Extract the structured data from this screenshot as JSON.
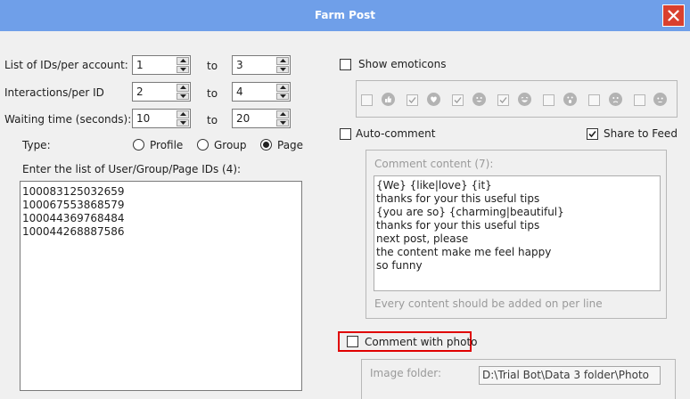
{
  "window": {
    "title": "Farm Post"
  },
  "left": {
    "ids_per_account": {
      "label": "List of IDs/per account:",
      "from": "1",
      "to_label": "to",
      "to": "3"
    },
    "interactions": {
      "label": "Interactions/per ID",
      "from": "2",
      "to_label": "to",
      "to": "4"
    },
    "waiting": {
      "label": "Waiting time (seconds):",
      "from": "10",
      "to_label": "to",
      "to": "20"
    },
    "type": {
      "label": "Type:",
      "options": [
        {
          "label": "Profile",
          "selected": false
        },
        {
          "label": "Group",
          "selected": false
        },
        {
          "label": "Page",
          "selected": true
        }
      ]
    },
    "ids_list_label": "Enter the list of User/Group/Page IDs (4):",
    "ids": [
      "100083125032659",
      "100067553868579",
      "100044369768484",
      "100044268887586"
    ]
  },
  "right": {
    "show_emoticons": {
      "label": "Show emoticons",
      "checked": false
    },
    "emoticons": [
      {
        "name": "like",
        "checked": false
      },
      {
        "name": "love",
        "checked": true
      },
      {
        "name": "haha",
        "checked": true
      },
      {
        "name": "wow",
        "checked": true
      },
      {
        "name": "sad",
        "checked": false
      },
      {
        "name": "angry",
        "checked": false
      },
      {
        "name": "care",
        "checked": false
      }
    ],
    "auto_comment": {
      "label": "Auto-comment",
      "checked": false
    },
    "share_to_feed": {
      "label": "Share to Feed",
      "checked": true
    },
    "comment_content": {
      "label": "Comment content (7):",
      "lines": [
        "{We} {like|love} {it}",
        "thanks for your this useful tips",
        "{you are so} {charming|beautiful}",
        "thanks for your this useful tips",
        "next post, please",
        "the content make me feel happy",
        "so funny"
      ],
      "hint": "Every content should be added on per line"
    },
    "comment_with_photo": {
      "label": "Comment with photo",
      "checked": false
    },
    "image_folder": {
      "label": "Image folder:",
      "value": "D:\\Trial Bot\\Data 3 folder\\Photo"
    }
  },
  "colors": {
    "titlebar": "#6f9fe9",
    "close": "#d9402e",
    "highlight": "#e00000"
  }
}
